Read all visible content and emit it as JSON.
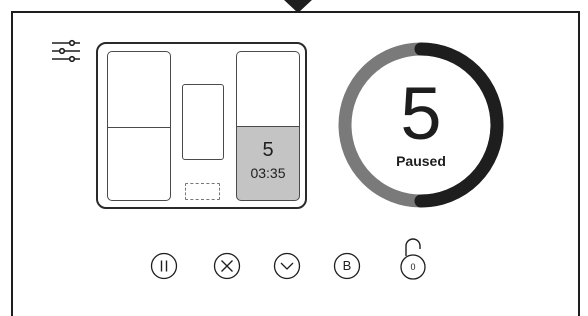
{
  "settings": {
    "icon": "sliders-icon"
  },
  "hob": {
    "zones": {
      "left_top": {
        "icon": "cooking-zone"
      },
      "left_bottom": {
        "icon": "cooking-zone"
      },
      "middle": {
        "icon": "cooking-zone"
      },
      "bridge": {
        "icon": "bridge-zone"
      },
      "right_top": {
        "icon": "cooking-zone"
      },
      "right_bottom": {
        "level": "5",
        "timer": "03:35",
        "selected": true,
        "fill_color": "#c4c4c4"
      }
    }
  },
  "dial": {
    "level": "5",
    "status": "Paused",
    "progress_fraction": 0.5,
    "track_color": "#7a7a7a",
    "progress_color": "#1e1e1e"
  },
  "controls": {
    "pause": {
      "icon": "pause-icon"
    },
    "stop": {
      "icon": "close-icon"
    },
    "down": {
      "icon": "chevron-down-icon"
    },
    "boost": {
      "label": "B",
      "icon": "boost-icon"
    },
    "lock": {
      "count": "0",
      "icon": "unlock-icon"
    }
  }
}
